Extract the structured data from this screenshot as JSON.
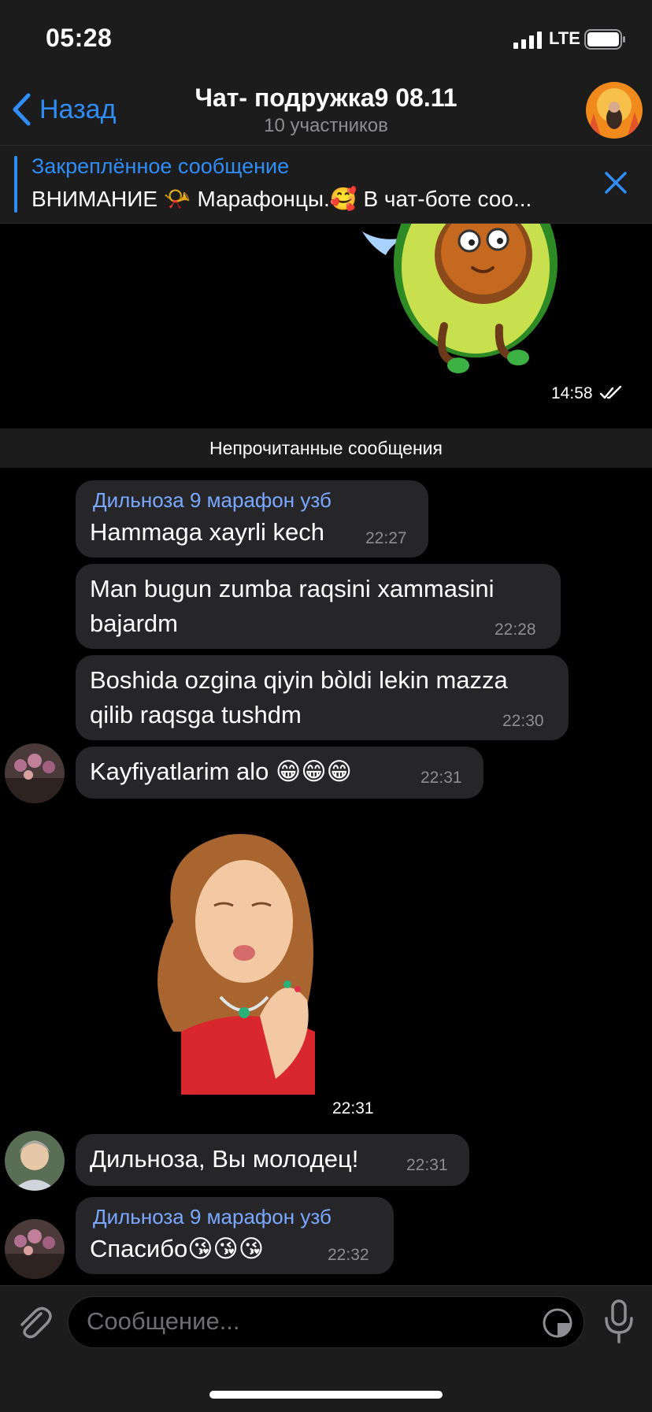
{
  "status": {
    "time": "05:28",
    "network": "LTE"
  },
  "header": {
    "back_label": "Назад",
    "title": "Чат- подружка9 08.11",
    "subtitle": "10 участников"
  },
  "pinned": {
    "title": "Закреплённое сообщение",
    "text": "ВНИМАНИЕ 📯 Марафонцы.🥰 В чат-боте соо..."
  },
  "sticker_top": {
    "time": "14:58"
  },
  "unread_label": "Непрочитанные сообщения",
  "messages": [
    {
      "sender": "Дильноза 9 марафон узб",
      "text": "Hammaga xayrli kech",
      "time": "22:27"
    },
    {
      "text_line1": "Man bugun zumba raqsini  xammasini",
      "text_line2": "bajardm",
      "time": "22:28"
    },
    {
      "text_line1": "Boshida ozgina qiyin bòldi lekin mazza",
      "text_line2": "qilib raqsga tushdm",
      "time": "22:30"
    },
    {
      "text": "Kayfiyatlarim alo 😁😁😁",
      "time": "22:31"
    },
    {
      "sticker_time": "22:31"
    },
    {
      "text": "Дильноза, Вы молодец!",
      "time": "22:31"
    },
    {
      "sender": "Дильноза 9 марафон узб",
      "text": "Спасибо😘😘😘",
      "time": "22:32"
    }
  ],
  "input": {
    "placeholder": "Сообщение..."
  },
  "colors": {
    "accent": "#2f8df5",
    "sender": "#7aa8ff",
    "bubble": "#262628",
    "bar": "#1c1c1d"
  }
}
